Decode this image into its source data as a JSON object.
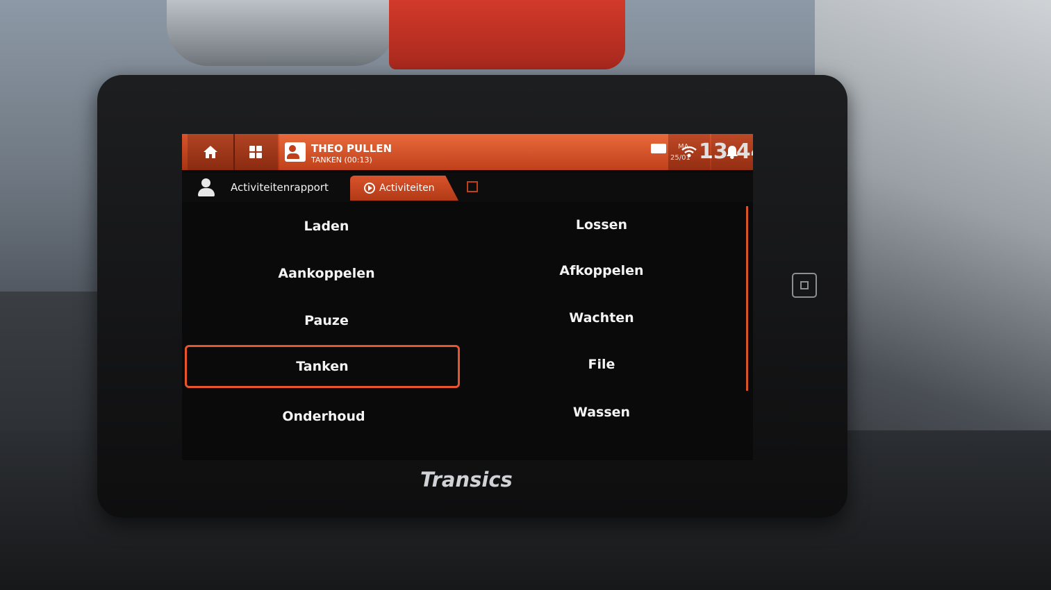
{
  "header": {
    "driver_name": "THEO PULLEN",
    "driver_status": "TANKEN (00:13)",
    "day": "MA",
    "date": "25/01",
    "time": "13:44"
  },
  "icons": {
    "home": "home-icon",
    "apps": "apps-grid-icon",
    "driver": "driver-card-icon",
    "message": "message-icon",
    "wifi": "wifi-icon",
    "bell": "bell-icon",
    "user": "user-icon",
    "play": "play-circle-icon",
    "edit": "edit-icon"
  },
  "subbar": {
    "report_label": "Activiteitenrapport",
    "active_tab": "Activiteiten"
  },
  "activities": {
    "left": [
      "Laden",
      "Aankoppelen",
      "Pauze",
      "Tanken",
      "Onderhoud"
    ],
    "right": [
      "Lossen",
      "Afkoppelen",
      "Wachten",
      "File",
      "Wassen"
    ],
    "selected": "Tanken"
  },
  "device": {
    "brand": "Transics"
  },
  "colors": {
    "accent": "#d9532b",
    "screen_bg": "#0a0a0a"
  }
}
